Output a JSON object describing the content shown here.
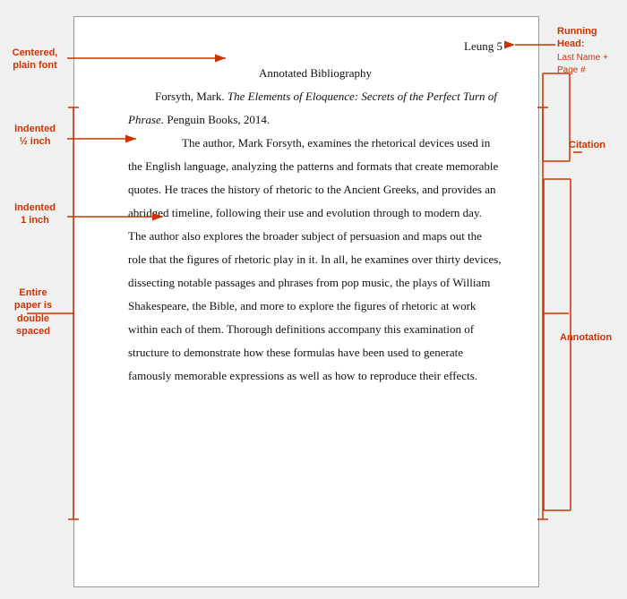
{
  "page": {
    "running_head": "Leung 5",
    "bib_title": "Annotated Bibliography",
    "citation": {
      "author": "Forsyth, Mark.",
      "title_italic": "The Elements of Eloquence: Secrets of the Perfect Turn of Phrase.",
      "publisher": "Penguin Books, 2014."
    },
    "annotation": "The author, Mark Forsyth, examines the rhetorical devices used in the English language, analyzing the patterns and formats that create memorable quotes. He traces the history of rhetoric to the Ancient Greeks, and provides an abridged timeline, following their use and evolution through to modern day. The author also explores the broader subject of persuasion and maps out the role that the figures of rhetoric play in it. In all, he examines over thirty devices, dissecting notable passages and phrases from pop music, the plays of William Shakespeare, the Bible, and more to explore the figures of rhetoric at work within each of them. Thorough definitions accompany this examination of structure to demonstrate how these formulas have been used to generate famously memorable expressions as well as how to reproduce their effects."
  },
  "labels": {
    "centered": "Centered,\nplain font",
    "half_inch": "Indented\n½ inch",
    "one_inch": "Indented\n1 inch",
    "double": "Entire\npaper is\ndouble\nspaced",
    "running_head": "Running\nHead:\nLast Name +\nPage #",
    "citation": "Citation",
    "annotation": "Annotation"
  },
  "arrows": {
    "centered_label": "Centered, plain font",
    "half_inch_label": "Indented ½ inch",
    "one_inch_label": "Indented 1 inch",
    "double_label": "Entire paper is double spaced",
    "running_head_label": "Running Head: Last Name + Page #",
    "citation_label": "Citation",
    "annotation_label": "Annotation"
  }
}
